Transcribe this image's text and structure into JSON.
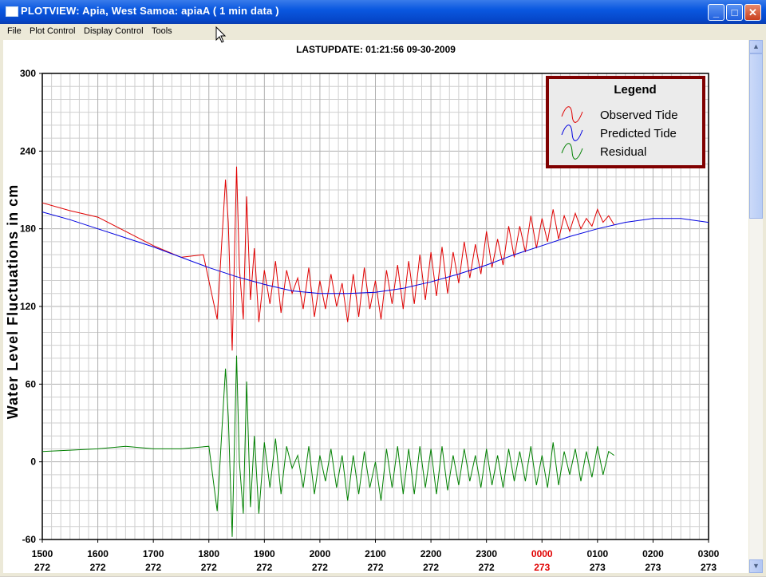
{
  "window": {
    "title": "PLOTVIEW:   Apia, West Samoa: apiaA (  1 min data )",
    "menu": [
      "File",
      "Plot Control",
      "Display Control",
      "Tools"
    ]
  },
  "colors": {
    "observed": "#e00000",
    "predicted": "#0000e0",
    "residual": "#008000",
    "legend_border": "#800000",
    "highlight_tick": "#e00000"
  },
  "chart_data": {
    "type": "line",
    "title": "LASTUPDATE: 01:21:56  09-30-2009",
    "ylabel": "Water Level Fluctuations in cm",
    "xlabel": "",
    "ylim": [
      -60,
      300
    ],
    "xlim": [
      0,
      12
    ],
    "yticks": [
      -60,
      0,
      60,
      120,
      180,
      240,
      300
    ],
    "xticks": [
      {
        "time": "1500",
        "day": "272"
      },
      {
        "time": "1600",
        "day": "272"
      },
      {
        "time": "1700",
        "day": "272"
      },
      {
        "time": "1800",
        "day": "272"
      },
      {
        "time": "1900",
        "day": "272"
      },
      {
        "time": "2000",
        "day": "272"
      },
      {
        "time": "2100",
        "day": "272"
      },
      {
        "time": "2200",
        "day": "272"
      },
      {
        "time": "2300",
        "day": "272"
      },
      {
        "time": "0000",
        "day": "273",
        "highlight": true
      },
      {
        "time": "0100",
        "day": "273"
      },
      {
        "time": "0200",
        "day": "273"
      },
      {
        "time": "0300",
        "day": "273"
      }
    ],
    "grid": true,
    "legend": {
      "title": "Legend",
      "placement": "top-right"
    },
    "series": [
      {
        "name": "Observed Tide",
        "color": "#e00000",
        "x": [
          0,
          0.5,
          1,
          1.5,
          2,
          2.5,
          2.9,
          3.15,
          3.3,
          3.35,
          3.42,
          3.5,
          3.55,
          3.62,
          3.68,
          3.75,
          3.82,
          3.9,
          4.0,
          4.1,
          4.2,
          4.3,
          4.4,
          4.5,
          4.6,
          4.7,
          4.8,
          4.9,
          5.0,
          5.1,
          5.2,
          5.3,
          5.4,
          5.5,
          5.6,
          5.7,
          5.8,
          5.9,
          6.0,
          6.1,
          6.2,
          6.3,
          6.4,
          6.5,
          6.6,
          6.7,
          6.8,
          6.9,
          7.0,
          7.1,
          7.2,
          7.3,
          7.4,
          7.5,
          7.6,
          7.7,
          7.8,
          7.9,
          8.0,
          8.1,
          8.2,
          8.3,
          8.4,
          8.5,
          8.6,
          8.7,
          8.8,
          8.9,
          9.0,
          9.1,
          9.2,
          9.3,
          9.4,
          9.5,
          9.6,
          9.7,
          9.8,
          9.9,
          10.0,
          10.1,
          10.2,
          10.3
        ],
        "values": [
          200,
          194,
          189,
          178,
          167,
          158,
          160,
          110,
          218,
          185,
          86,
          228,
          150,
          110,
          205,
          125,
          165,
          108,
          148,
          122,
          155,
          115,
          148,
          130,
          142,
          118,
          150,
          112,
          140,
          118,
          145,
          120,
          138,
          108,
          145,
          112,
          150,
          118,
          140,
          110,
          148,
          122,
          152,
          118,
          155,
          122,
          160,
          125,
          162,
          128,
          166,
          130,
          162,
          138,
          170,
          142,
          168,
          145,
          178,
          150,
          172,
          152,
          182,
          158,
          182,
          162,
          190,
          165,
          188,
          170,
          195,
          172,
          190,
          178,
          192,
          180,
          188,
          182,
          195,
          185,
          190,
          183
        ]
      },
      {
        "name": "Predicted Tide",
        "color": "#0000e0",
        "x": [
          0,
          0.5,
          1,
          1.5,
          2,
          2.5,
          3,
          3.5,
          4,
          4.5,
          5,
          5.5,
          6,
          6.5,
          7,
          7.5,
          8,
          8.5,
          9,
          9.5,
          10,
          10.5,
          11,
          11.5,
          12
        ],
        "values": [
          193,
          187,
          180,
          173,
          166,
          158,
          150,
          143,
          137,
          132,
          130,
          130,
          131,
          134,
          139,
          145,
          152,
          160,
          167,
          174,
          180,
          185,
          188,
          188,
          185
        ]
      },
      {
        "name": "Residual",
        "color": "#008000",
        "x": [
          0,
          0.5,
          1,
          1.5,
          2,
          2.5,
          3,
          3.15,
          3.3,
          3.35,
          3.42,
          3.5,
          3.55,
          3.62,
          3.68,
          3.75,
          3.82,
          3.9,
          4.0,
          4.1,
          4.2,
          4.3,
          4.4,
          4.5,
          4.6,
          4.7,
          4.8,
          4.9,
          5.0,
          5.1,
          5.2,
          5.3,
          5.4,
          5.5,
          5.6,
          5.7,
          5.8,
          5.9,
          6.0,
          6.1,
          6.2,
          6.3,
          6.4,
          6.5,
          6.6,
          6.7,
          6.8,
          6.9,
          7.0,
          7.1,
          7.2,
          7.3,
          7.4,
          7.5,
          7.6,
          7.7,
          7.8,
          7.9,
          8.0,
          8.1,
          8.2,
          8.3,
          8.4,
          8.5,
          8.6,
          8.7,
          8.8,
          8.9,
          9.0,
          9.1,
          9.2,
          9.3,
          9.4,
          9.5,
          9.6,
          9.7,
          9.8,
          9.9,
          10.0,
          10.1,
          10.2,
          10.3
        ],
        "values": [
          8,
          9,
          10,
          12,
          10,
          10,
          12,
          -38,
          72,
          35,
          -58,
          82,
          0,
          -40,
          62,
          -35,
          20,
          -40,
          15,
          -20,
          18,
          -25,
          12,
          -5,
          5,
          -20,
          12,
          -25,
          5,
          -15,
          10,
          -20,
          5,
          -30,
          5,
          -25,
          8,
          -20,
          0,
          -30,
          10,
          -20,
          12,
          -25,
          10,
          -25,
          12,
          -20,
          10,
          -25,
          12,
          -22,
          5,
          -18,
          10,
          -15,
          5,
          -20,
          10,
          -18,
          5,
          -20,
          10,
          -15,
          8,
          -15,
          12,
          -18,
          5,
          -20,
          15,
          -18,
          8,
          -10,
          10,
          -15,
          8,
          -12,
          12,
          -10,
          8,
          5
        ]
      }
    ]
  }
}
